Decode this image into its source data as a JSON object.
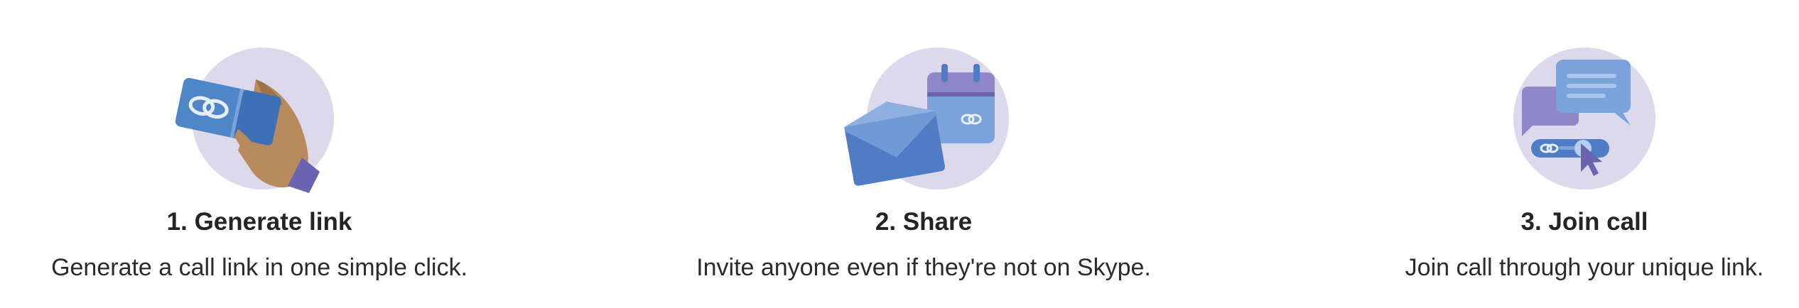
{
  "steps": [
    {
      "title": "1. Generate link",
      "description": "Generate a call link in one simple click.",
      "icon": "hand-holding-link-card-icon"
    },
    {
      "title": "2. Share",
      "description": "Invite anyone even if they're not on Skype.",
      "icon": "envelope-calendar-icon"
    },
    {
      "title": "3. Join call",
      "description": "Join call through your unique link.",
      "icon": "chat-bubbles-cursor-icon"
    }
  ],
  "colors": {
    "circle": "#dcd9ec",
    "blue": "#4f7cc4",
    "light_blue": "#7aa3dc",
    "purple": "#8f87c8",
    "skin": "#b88a5e",
    "text": "#242424"
  }
}
